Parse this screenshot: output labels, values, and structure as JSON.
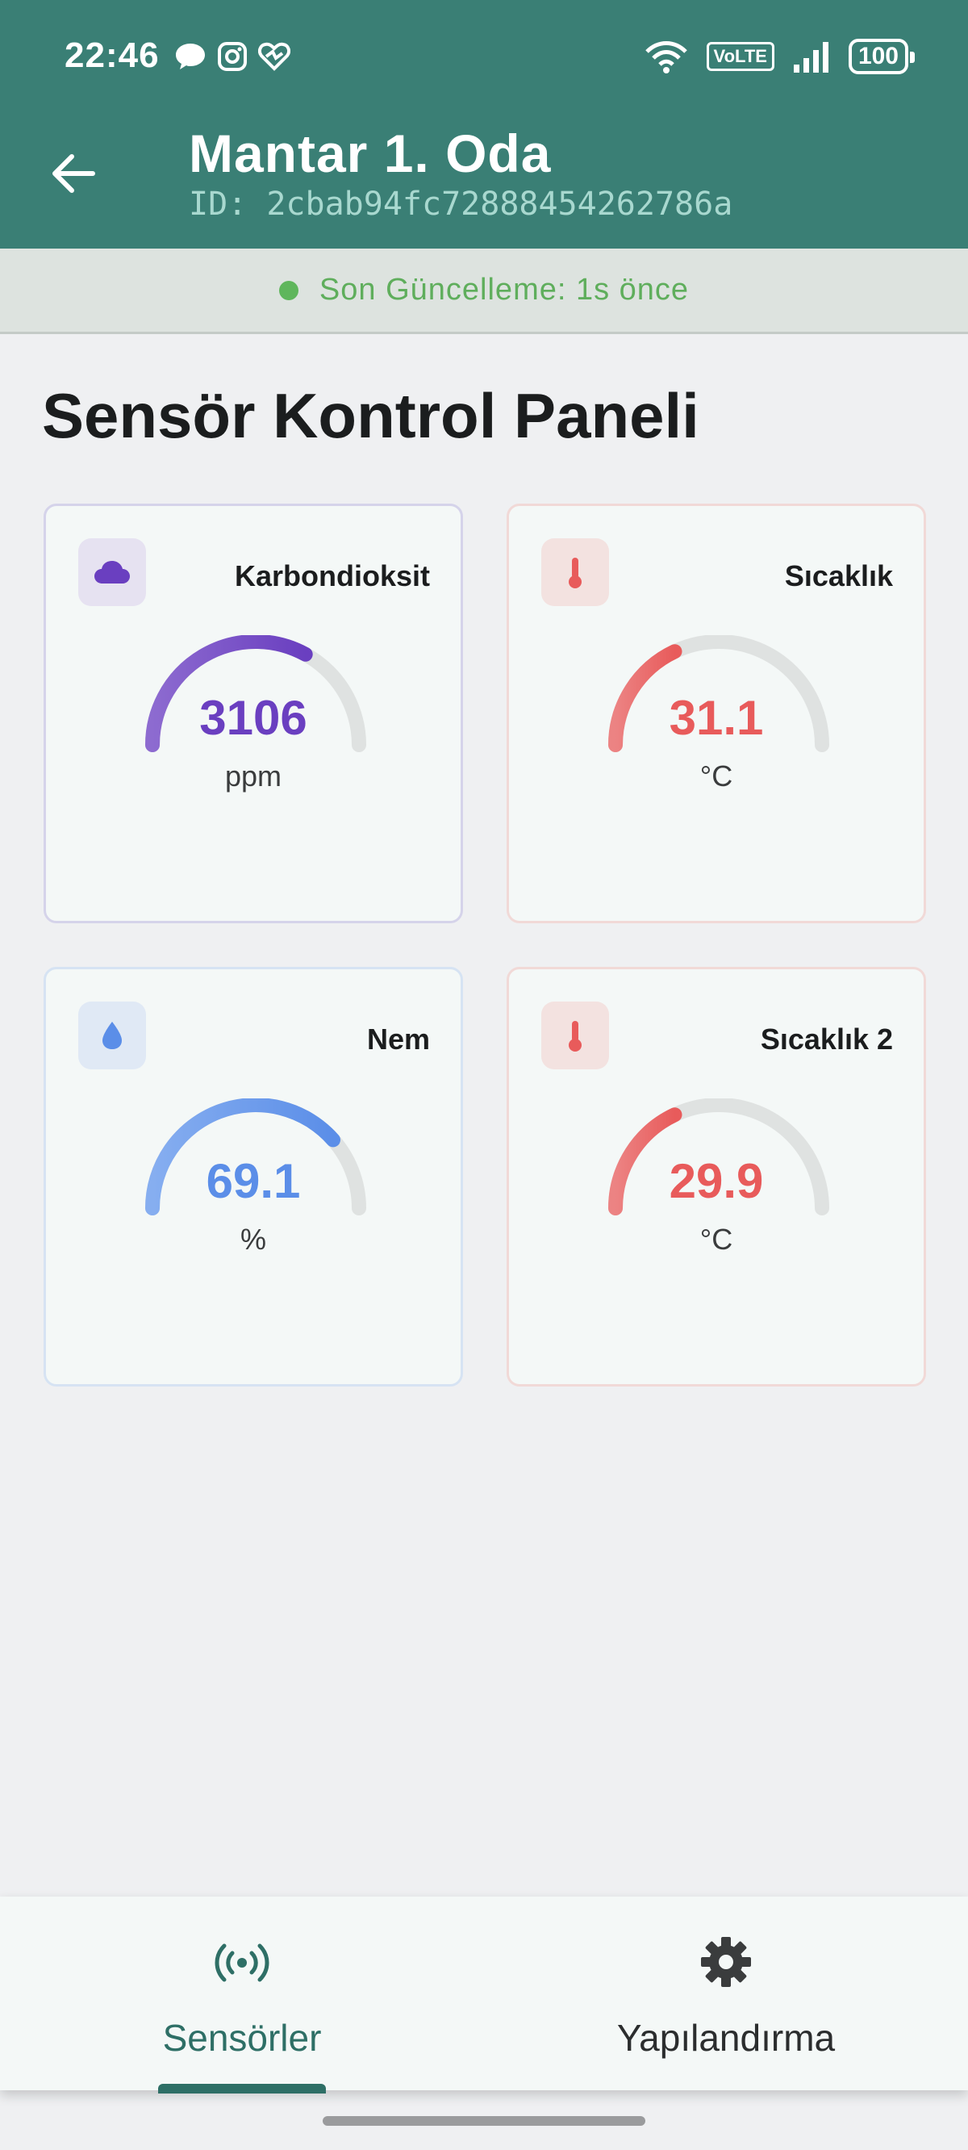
{
  "status_bar": {
    "time": "22:46",
    "volte": "VoLTE",
    "battery": "100"
  },
  "header": {
    "title": "Mantar 1. Oda",
    "device_id": "ID: 2cbab94fc72888454262786a"
  },
  "update_bar": {
    "text": "Son Güncelleme: 1s önce",
    "color": "#5fae5c"
  },
  "panel": {
    "title": "Sensör Kontrol Paneli",
    "sensors": [
      {
        "label": "Karbondioksit",
        "value": "3106",
        "unit": "ppm",
        "icon": "cloud-icon",
        "color": "#6a3fc0",
        "fill_fraction": 0.66
      },
      {
        "label": "Sıcaklık",
        "value": "31.1",
        "unit": "°C",
        "icon": "thermometer-icon",
        "color": "#e85b5b",
        "fill_fraction": 0.36
      },
      {
        "label": "Nem",
        "value": "69.1",
        "unit": "%",
        "icon": "water-drop-icon",
        "color": "#5b8ee8",
        "fill_fraction": 0.77
      },
      {
        "label": "Sıcaklık 2",
        "value": "29.9",
        "unit": "°C",
        "icon": "thermometer-icon",
        "color": "#e85b5b",
        "fill_fraction": 0.36
      }
    ]
  },
  "bottom_nav": {
    "items": [
      {
        "label": "Sensörler",
        "icon": "broadcast-icon",
        "active": true
      },
      {
        "label": "Yapılandırma",
        "icon": "gear-icon",
        "active": false
      }
    ]
  },
  "colors": {
    "header": "#3a7f75",
    "active_nav": "#2e6f66"
  }
}
